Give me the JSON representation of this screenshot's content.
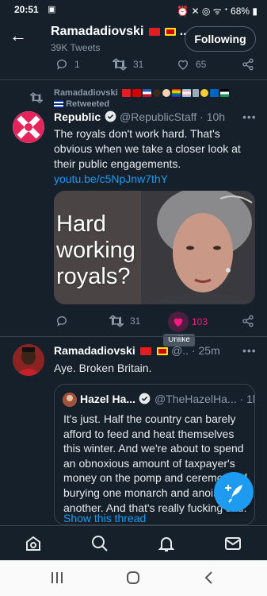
{
  "status_bar": {
    "time": "20:51",
    "icons_left": "▣",
    "icons_right": "⏰ ✕ ◎ ᯤ ᐩ",
    "battery": "68%"
  },
  "header": {
    "title": "Ramadadiovski",
    "title_suffix": "...",
    "subtitle": "39K Tweets",
    "follow_label": "Following"
  },
  "prev_actions": {
    "replies": "1",
    "retweets": "31",
    "likes": "65"
  },
  "retweet_line": {
    "user": "Ramadadiovski",
    "label": "Retweeted"
  },
  "tweet1": {
    "name": "Republic",
    "handle": "@RepublicStaff · 10h",
    "text": "The royals don't work hard. That's obvious when we take a closer look at their public engagements.",
    "link": "youtu.be/c5NpJnw7thY",
    "media_text": "Hard working royals?",
    "retweets": "31",
    "likes": "103",
    "tooltip": "Unlike"
  },
  "tweet2": {
    "name": "Ramadadiovski",
    "handle": "@.. · 25m",
    "text": "Aye. Broken Britain."
  },
  "quote": {
    "name": "Hazel Ha...",
    "handle": "@TheHazelHa... · 1h",
    "text": "It's just. Half the country can barely afford to feed and heat themselves this winter. And we're about to spend an obnoxious amount of taxpayer's money on the pomp and ceremony of burying one monarch and anointing another. And that's really fucking sad.",
    "show_thread": "Show this thread"
  },
  "colors": {
    "background": "#15202b",
    "accent": "#1d9bf0",
    "like": "#f91880",
    "muted": "#8b98a5"
  }
}
